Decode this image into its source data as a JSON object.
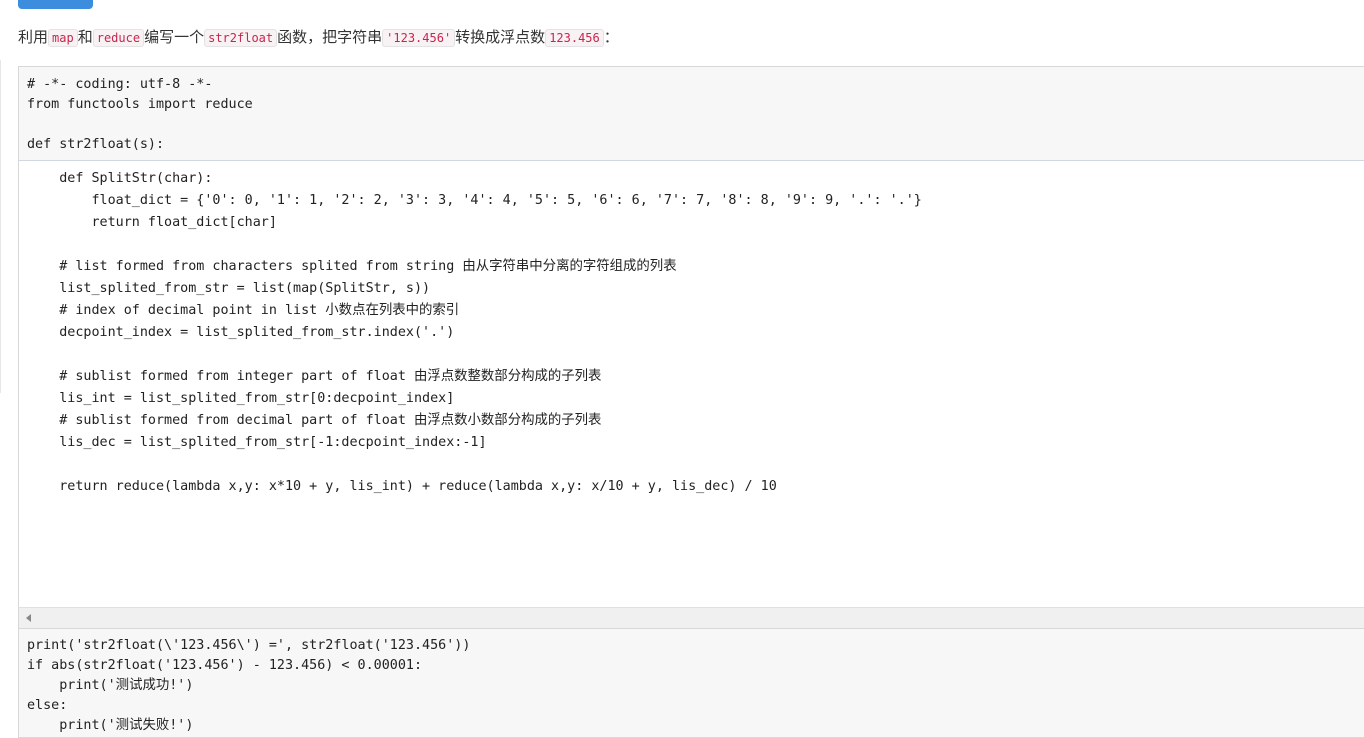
{
  "instruction": {
    "text_before": "利用",
    "code1": "map",
    "text_and": "和",
    "code2": "reduce",
    "text_write": "编写一个",
    "code3": "str2float",
    "text_convert": "函数，把字符串",
    "code4": "'123.456'",
    "text_to": "转换成浮点数",
    "code5": "123.456",
    "text_end": "："
  },
  "code_header": "# -*- coding: utf-8 -*-\nfrom functools import reduce\n\ndef str2float(s):",
  "code_body": "    def SplitStr(char):\n        float_dict = {'0': 0, '1': 1, '2': 2, '3': 3, '4': 4, '5': 5, '6': 6, '7': 7, '8': 8, '9': 9, '.': '.'}\n        return float_dict[char]\n\n    # list formed from characters splited from string 由从字符串中分离的字符组成的列表\n    list_splited_from_str = list(map(SplitStr, s))\n    # index of decimal point in list 小数点在列表中的索引\n    decpoint_index = list_splited_from_str.index('.')\n\n    # sublist formed from integer part of float 由浮点数整数部分构成的子列表\n    lis_int = list_splited_from_str[0:decpoint_index]\n    # sublist formed from decimal part of float 由浮点数小数部分构成的子列表\n    lis_dec = list_splited_from_str[-1:decpoint_index:-1]\n\n    return reduce(lambda x,y: x*10 + y, lis_int) + reduce(lambda x,y: x/10 + y, lis_dec) / 10",
  "code_footer": "print('str2float(\\'123.456\\') =', str2float('123.456'))\nif abs(str2float('123.456') - 123.456) < 0.00001:\n    print('测试成功!')\nelse:\n    print('测试失败!')"
}
